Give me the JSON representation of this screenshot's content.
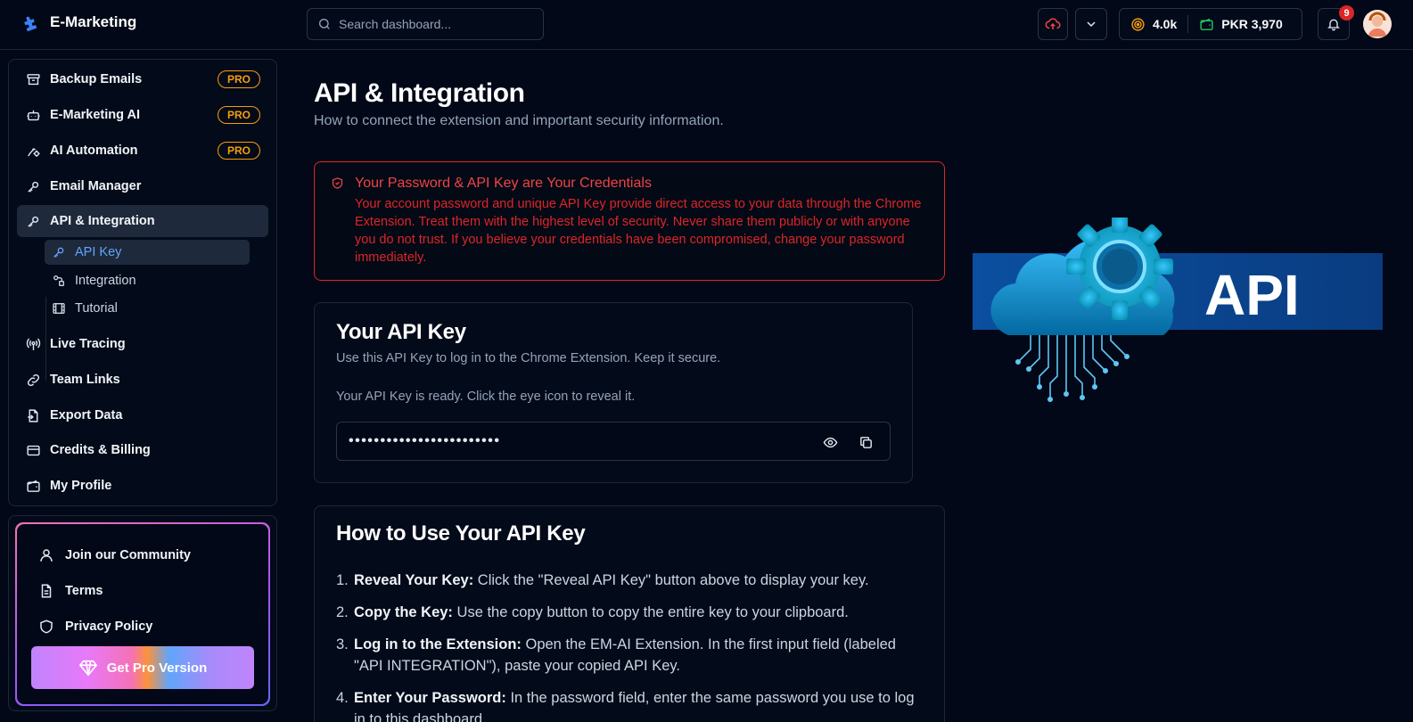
{
  "app": {
    "title": "E-Marketing",
    "logo_icon": "puzzle-icon"
  },
  "search": {
    "placeholder": "Search dashboard..."
  },
  "header": {
    "coins": "4.0k",
    "balance": "PKR 3,970",
    "notification_count": "9",
    "colors": {
      "accent": "#60a5fa",
      "pro": "#f59e0b",
      "danger": "#dc2626"
    }
  },
  "sidebar": {
    "items": [
      {
        "label": "Backup Emails",
        "badge": "PRO",
        "icon": "archive-icon"
      },
      {
        "label": "E-Marketing AI",
        "badge": "PRO",
        "icon": "bot-icon"
      },
      {
        "label": "AI Automation",
        "badge": "PRO",
        "icon": "automation-icon"
      },
      {
        "label": "Email Manager",
        "icon": "key-icon"
      },
      {
        "label": "API & Integration",
        "icon": "key-icon",
        "active": true
      },
      {
        "label": "Live Tracing",
        "icon": "radio-icon"
      },
      {
        "label": "Team Links",
        "icon": "link-icon"
      },
      {
        "label": "Export Data",
        "icon": "file-export-icon"
      },
      {
        "label": "Credits & Billing",
        "icon": "credit-card-icon"
      },
      {
        "label": "My Profile",
        "icon": "wallet-icon"
      }
    ],
    "subitems": [
      {
        "label": "API Key",
        "icon": "key-icon",
        "active": true
      },
      {
        "label": "Integration",
        "icon": "integration-icon"
      },
      {
        "label": "Tutorial",
        "icon": "film-icon"
      }
    ],
    "footer": {
      "community": "Join our Community",
      "terms": "Terms",
      "privacy": "Privacy Policy",
      "pro_button": "Get Pro Version"
    }
  },
  "main": {
    "title": "API & Integration",
    "subtitle": "How to connect the extension and important security information.",
    "alert": {
      "title": "Your Password & API Key are Your Credentials",
      "text": "Your account password and unique API Key provide direct access to your data through the Chrome Extension. Treat them with the highest level of security. Never share them publicly or with anyone you do not trust. If you believe your credentials have been compromised, change your password immediately."
    },
    "api_key_card": {
      "title": "Your API Key",
      "description": "Use this API Key to log in to the Chrome Extension. Keep it secure.",
      "status": "Your API Key is ready. Click the eye icon to reveal it.",
      "masked_key": "••••••••••••••••••••••••"
    },
    "howto": {
      "title": "How to Use Your API Key",
      "steps": [
        {
          "num": "1.",
          "bold": "Reveal Your Key:",
          "text": " Click the \"Reveal API Key\" button above to display your key."
        },
        {
          "num": "2.",
          "bold": "Copy the Key:",
          "text": " Use the copy button to copy the entire key to your clipboard."
        },
        {
          "num": "3.",
          "bold": "Log in to the Extension:",
          "text": " Open the EM-AI Extension. In the first input field (labeled \"API INTEGRATION\"), paste your copied API Key."
        },
        {
          "num": "4.",
          "bold": "Enter Your Password:",
          "text": " In the password field, enter the same password you use to log in to this dashboard."
        }
      ]
    },
    "illustration_text": "API"
  }
}
